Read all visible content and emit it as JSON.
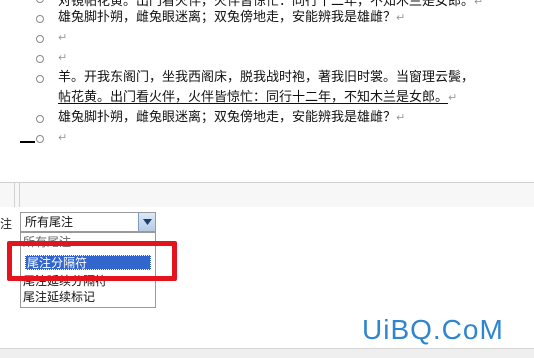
{
  "document": {
    "lines": [
      {
        "text": "对镜帖花黄。出门看火伴，火伴皆惊忙：同行十二年，不知木兰是女郎。",
        "mark": "↵"
      },
      {
        "text": "雄兔脚扑朔，雌兔眼迷离；双兔傍地走，安能辨我是雄雌？",
        "mark": "↵"
      },
      {
        "text": "",
        "mark": "↵"
      },
      {
        "text": "",
        "mark": "↵"
      },
      {
        "text": "羊。开我东阁门，坐我西阁床，脱我战时袍，著我旧时裳。当窗理云鬓，",
        "mark": ""
      },
      {
        "text": "帖花黄。出门看火伴，火伴皆惊忙：同行十二年，不知木兰是女郎。",
        "mark": "↵"
      },
      {
        "text": "雄兔脚扑朔，雌兔眼迷离；双兔傍地走，安能辨我是雄雌？",
        "mark": "↵"
      },
      {
        "text": "",
        "mark": "↵"
      }
    ]
  },
  "notes_pane": {
    "label": "尾注",
    "select_value": "所有尾注",
    "options": [
      "所有尾注",
      "尾注分隔符",
      "尾注延续分隔符",
      "尾注延续标记"
    ],
    "selected_index": 1
  },
  "watermark": "UiBQ.CoM",
  "colors": {
    "highlight": "#e3141c",
    "selection": "#3366cc",
    "watermark": "#2f86cf"
  }
}
